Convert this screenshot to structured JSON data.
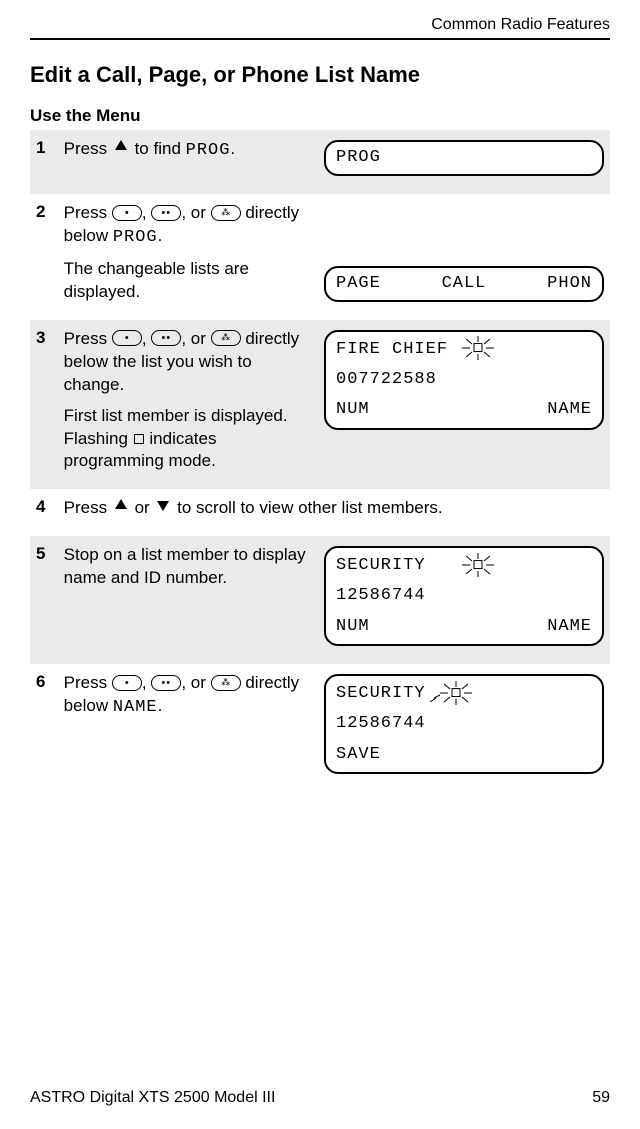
{
  "header": {
    "running": "Common Radio Features"
  },
  "title": "Edit a Call, Page, or Phone List Name",
  "subtitle": "Use the Menu",
  "steps": {
    "s1": {
      "num": "1",
      "pre": "Press ",
      "mid": " to find ",
      "code": "PROG",
      "post": "."
    },
    "s2": {
      "num": "2",
      "pre": "Press ",
      "sep": ", ",
      "or": ", or ",
      "mid": " directly below ",
      "code": "PROG",
      "post": ".",
      "para2": "The changeable lists are displayed."
    },
    "s3": {
      "num": "3",
      "pre": "Press ",
      "sep": ", ",
      "or": ", or ",
      "mid": " directly below the list you wish to change.",
      "para2a": "First list member is displayed. Flashing ",
      "para2b": " indicates programming mode."
    },
    "s4": {
      "num": "4",
      "pre": "Press ",
      "or": " or ",
      "mid": " to scroll to view other list members."
    },
    "s5": {
      "num": "5",
      "text": "Stop on a list member to display name and ID number."
    },
    "s6": {
      "num": "6",
      "pre": "Press ",
      "sep": ", ",
      "or": ", or ",
      "mid": " directly below ",
      "code": "NAME",
      "post": "."
    }
  },
  "lcd": {
    "panel1": {
      "line1": "PROG"
    },
    "panel2": {
      "c1": "PAGE",
      "c2": "CALL",
      "c3": "PHON"
    },
    "panel3": {
      "line1": "FIRE CHIEF",
      "line2": "007722588",
      "bL": "NUM",
      "bR": "NAME"
    },
    "panel5": {
      "line1": "SECURITY",
      "line2": "12586744",
      "bL": "NUM",
      "bR": "NAME"
    },
    "panel6": {
      "line1": "SECURITY",
      "line2": "12586744",
      "bL": "SAVE"
    }
  },
  "footer": {
    "left": "ASTRO Digital XTS 2500 Model III",
    "right": "59"
  }
}
